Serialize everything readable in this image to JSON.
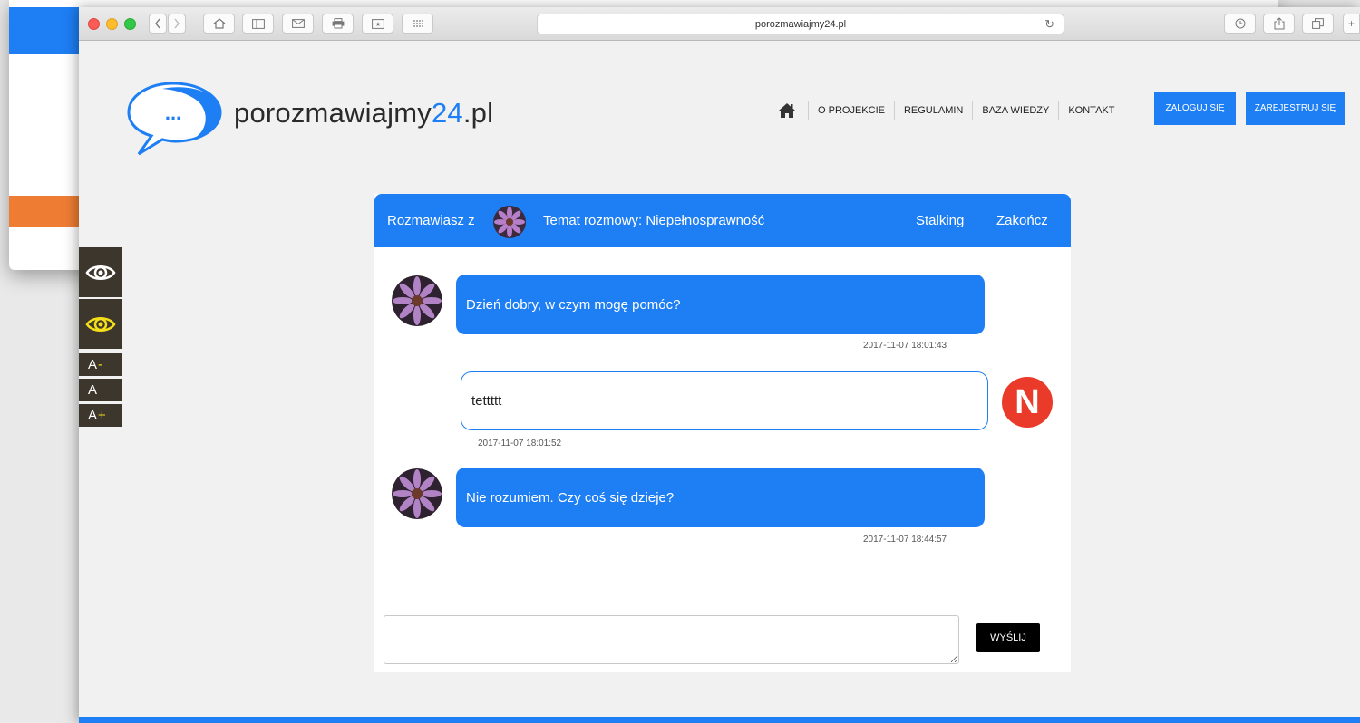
{
  "browser": {
    "url": "porozmawiajmy24.pl"
  },
  "site": {
    "logo_prefix": "porozmawiajmy",
    "logo_number": "24",
    "logo_suffix": ".pl",
    "logo_dots": "..."
  },
  "nav": {
    "items": [
      "O PROJEKCIE",
      "REGULAMIN",
      "BAZA WIEDZY",
      "KONTAKT"
    ],
    "login": "ZALOGUJ SIĘ",
    "register": "ZAREJESTRUJ SIĘ"
  },
  "accessibility": {
    "font_smaller": "A",
    "font_smaller_mark": "-",
    "font_normal": "A",
    "font_larger": "A",
    "font_larger_mark": "+"
  },
  "chat": {
    "talking_with": "Rozmawiasz z",
    "topic": "Temat rozmowy: Niepełnosprawność",
    "stalking": "Stalking",
    "end": "Zakończ",
    "messages": [
      {
        "text": "Dzień dobry, w czym mogę pomóc?",
        "time": "2017-11-07 18:01:43"
      },
      {
        "text": "tettttt",
        "time": "2017-11-07 18:01:52"
      },
      {
        "text": "Nie rozumiem. Czy coś się dzieje?",
        "time": "2017-11-07 18:44:57"
      }
    ],
    "user_initial": "N",
    "send": "WYŚLIJ"
  }
}
